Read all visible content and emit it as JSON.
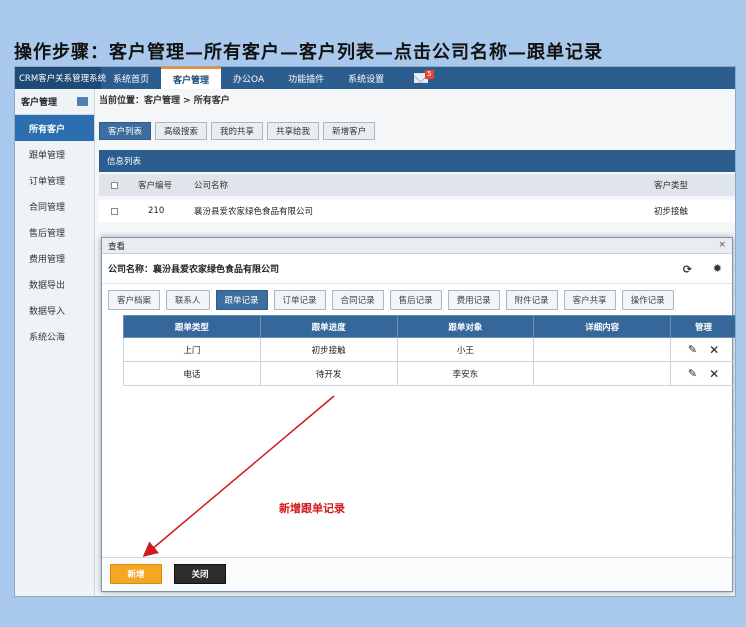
{
  "headline": "操作步骤：客户管理—所有客户—客户列表—点击公司名称—跟单记录",
  "topnav": {
    "logo": "CRM客户关系管理系统",
    "items": [
      {
        "label": "系统首页",
        "active": false
      },
      {
        "label": "客户管理",
        "active": true
      },
      {
        "label": "办公OA",
        "active": false
      },
      {
        "label": "功能插件",
        "active": false
      },
      {
        "label": "系统设置",
        "active": false
      }
    ],
    "mail_badge": "5"
  },
  "sidebar": {
    "title": "客户管理",
    "items": [
      {
        "label": "所有客户",
        "active": true
      },
      {
        "label": "跟单管理"
      },
      {
        "label": "订单管理"
      },
      {
        "label": "合同管理"
      },
      {
        "label": "售后管理"
      },
      {
        "label": "费用管理"
      },
      {
        "label": "数据导出"
      },
      {
        "label": "数据导入"
      },
      {
        "label": "系统公海"
      }
    ]
  },
  "breadcrumb": "当前位置：客户管理 > 所有客户",
  "tabs": [
    {
      "label": "客户列表",
      "active": true
    },
    {
      "label": "高级搜索"
    },
    {
      "label": "我的共享"
    },
    {
      "label": "共享给我"
    },
    {
      "label": "新增客户"
    }
  ],
  "list": {
    "title": "信息列表",
    "headers": {
      "id": "客户编号",
      "company": "公司名称",
      "type": "客户类型"
    },
    "row": {
      "id": "210",
      "company": "襄汾县爱农家绿色食品有限公司",
      "type": "初步接触"
    }
  },
  "modal": {
    "title": "查看",
    "close": "×",
    "company_label": "公司名称：襄汾县爱农家绿色食品有限公司",
    "subtabs": [
      {
        "label": "客户档案"
      },
      {
        "label": "联系人"
      },
      {
        "label": "跟单记录",
        "active": true
      },
      {
        "label": "订单记录"
      },
      {
        "label": "合同记录"
      },
      {
        "label": "售后记录"
      },
      {
        "label": "费用记录"
      },
      {
        "label": "附件记录"
      },
      {
        "label": "客户共享"
      },
      {
        "label": "操作记录"
      }
    ],
    "table": {
      "headers": [
        "跟单类型",
        "跟单进度",
        "跟单对象",
        "详细内容",
        "管理"
      ],
      "rows": [
        [
          "上门",
          "初步接触",
          "小王",
          ""
        ],
        [
          "电话",
          "待开发",
          "李安东",
          ""
        ]
      ]
    },
    "annotation": "新增跟单记录",
    "buttons": {
      "new": "新增",
      "close": "关闭"
    }
  },
  "colors": {
    "nav": "#2c5d8f",
    "accent": "#f5a623",
    "arrow": "#d21a1a"
  }
}
